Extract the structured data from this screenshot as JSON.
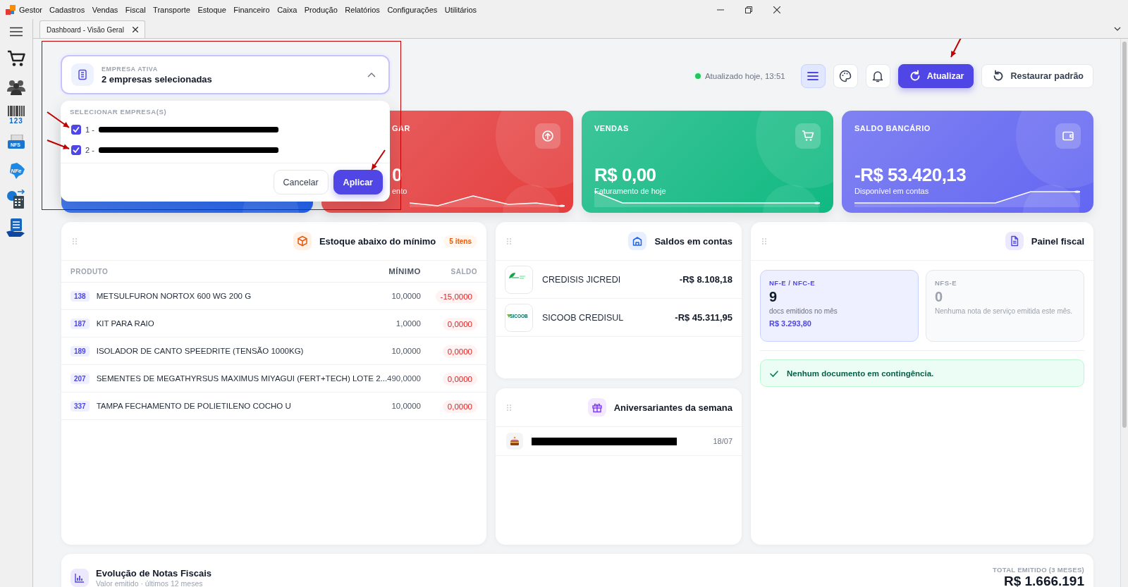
{
  "menu_bar": {
    "app": "Gestor",
    "items": [
      "Cadastros",
      "Vendas",
      "Fiscal",
      "Transporte",
      "Estoque",
      "Financeiro",
      "Caixa",
      "Produção",
      "Relatórios",
      "Configurações",
      "Utilitários"
    ]
  },
  "sidebar": {
    "items": [
      {
        "kind": "menu"
      },
      {
        "kind": "cart"
      },
      {
        "kind": "people"
      },
      {
        "kind": "barcode",
        "label": "123"
      },
      {
        "kind": "nfse",
        "label": "NFS"
      },
      {
        "kind": "nfe",
        "label": "NFe"
      },
      {
        "kind": "calculator"
      },
      {
        "kind": "money"
      }
    ]
  },
  "tabs": [
    {
      "label": "Dashboard - Visão Geral",
      "selected": true
    }
  ],
  "header": {
    "status": "Atualizado hoje, 13:51",
    "online": true,
    "icon_buttons": [
      {
        "kind": "menu",
        "selected": true
      },
      {
        "kind": "palette",
        "selected": false
      },
      {
        "kind": "bell",
        "selected": false
      }
    ],
    "action_buttons": [
      {
        "kind": "refresh",
        "label": "Atualizar"
      },
      {
        "kind": "restore",
        "label": "Restaurar padrão"
      }
    ]
  },
  "company_select": {
    "label": "EMPRESA ATIVA",
    "value": "2 empresas selecionadas",
    "expanded": true,
    "options_heading": "SELECIONAR EMPRESA(S)",
    "options": [
      {
        "label": "1 -",
        "checked": true,
        "redacted": true
      },
      {
        "label": "2 -",
        "checked": true,
        "redacted": true
      }
    ],
    "buttons": [
      {
        "kind": "secondary",
        "label": "Cancelar"
      },
      {
        "kind": "primary",
        "label": "Aplicar"
      }
    ]
  },
  "kpi_cards": [
    {
      "kind": "receivable",
      "color": "#2563eb"
    },
    {
      "kind": "payable",
      "color": "#e53e3e",
      "title": "GAR",
      "value": "0",
      "subtitle": "ento"
    },
    {
      "kind": "sales",
      "color": "#10b981",
      "title": "VENDAS",
      "value": "R$ 0,00",
      "subtitle": "Faturamento de hoje"
    },
    {
      "kind": "bank",
      "color": "#6366f1",
      "title": "SALDO BANCÁRIO",
      "value": "-R$ 53.420,13",
      "subtitle": "Disponível em contas"
    }
  ],
  "stock_panel": {
    "title": "Estoque abaixo do mínimo",
    "badge": "5 itens",
    "columns": [
      "PRODUTO",
      "MÍNIMO",
      "SALDO"
    ],
    "rows": [
      {
        "code": "138",
        "product": "METSULFURON NORTOX 600 WG 200 G",
        "minimum": "10,0000",
        "balance": "-15,0000"
      },
      {
        "code": "187",
        "product": "KIT PARA RAIO",
        "minimum": "1,0000",
        "balance": "0,0000"
      },
      {
        "code": "189",
        "product": "ISOLADOR DE CANTO SPEEDRITE (TENSÃO 1000KG)",
        "minimum": "10,0000",
        "balance": "0,0000"
      },
      {
        "code": "207",
        "product": "SEMENTES DE MEGATHYRSUS MAXIMUS MIYAGUI (FERT+TECH) LOTE 2...",
        "minimum": "490,0000",
        "balance": "0,0000"
      },
      {
        "code": "337",
        "product": "TAMPA FECHAMENTO DE POLIETILENO COCHO U",
        "minimum": "10,0000",
        "balance": "0,0000"
      }
    ]
  },
  "accounts_panel": {
    "title": "Saldos em contas",
    "rows": [
      {
        "kind": "leaf",
        "name": "CREDISIS JICREDI",
        "amount": "-R$ 8.108,18"
      },
      {
        "kind": "sicoob",
        "logo_text": "SICOOB",
        "name": "SICOOB CREDISUL",
        "amount": "-R$ 45.311,95"
      }
    ]
  },
  "birthdays_panel": {
    "title": "Aniversariantes da semana",
    "rows": [
      {
        "redacted": true,
        "date": "18/07"
      }
    ]
  },
  "fiscal_panel": {
    "title": "Painel fiscal",
    "cards": [
      {
        "label": "NF-E / NFC-E",
        "count": "9",
        "caption": "docs emitidos no mês",
        "amount": "R$ 3.293,80",
        "selected": true
      },
      {
        "label": "NFS-E",
        "count": "0",
        "caption": "Nenhuma nota de serviço emitida este mês.",
        "selected": false
      }
    ],
    "alert": "Nenhum documento em contingência."
  },
  "notes_panel": {
    "title": "Evolução de Notas Fiscais",
    "subtitle": "Valor emitido · últimos 12 meses",
    "total_label": "TOTAL EMITIDO (3 MESES)",
    "total": "R$ 1.666.191"
  }
}
